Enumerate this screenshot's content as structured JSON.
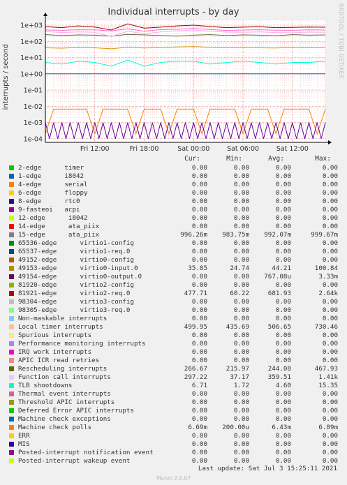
{
  "chart_data": {
    "type": "line",
    "title": "Individual interrupts - by day",
    "side_credit": "RRDTOOL / TOBI OETIKER",
    "ylabel": "interrupts / second",
    "yscale": "log",
    "ylim": [
      6e-05,
      2000
    ],
    "ytick_labels": [
      "1e+03",
      "1e+02",
      "1e+01",
      "1e+00",
      "1e-01",
      "1e-02",
      "1e-03",
      "1e-04"
    ],
    "xtick_labels": [
      "Fri 12:00",
      "Fri 18:00",
      "Sat 00:00",
      "Sat 06:00",
      "Sat 12:00"
    ],
    "grid": true,
    "series": [
      {
        "name": "Rescheduling interrupts",
        "color": "#556b2f",
        "x_hours": [
          6,
          8,
          10,
          12,
          14,
          16,
          18,
          20,
          22,
          24,
          26,
          28,
          30,
          32,
          34,
          36,
          38,
          40
        ],
        "values": [
          260,
          230,
          250,
          240,
          210,
          270,
          250,
          230,
          210,
          240,
          260,
          230,
          250,
          240,
          220,
          260,
          240,
          250
        ]
      },
      {
        "name": "Local timer interrupts",
        "color": "#ff66cc",
        "x_hours": [
          6,
          8,
          10,
          12,
          14,
          16,
          18,
          20,
          22,
          24,
          26,
          28,
          30,
          32,
          34,
          36,
          38,
          40
        ],
        "values": [
          500,
          480,
          520,
          510,
          440,
          600,
          420,
          530,
          560,
          620,
          540,
          470,
          500,
          520,
          490,
          480,
          510,
          500
        ]
      },
      {
        "name": "Function call interrupts",
        "color": "#ffaaee",
        "x_hours": [
          6,
          8,
          10,
          12,
          14,
          16,
          18,
          20,
          22,
          24,
          26,
          28,
          30,
          32,
          34,
          36,
          38,
          40
        ],
        "values": [
          400,
          350,
          380,
          360,
          200,
          420,
          300,
          380,
          450,
          500,
          420,
          370,
          360,
          380,
          350,
          340,
          370,
          360
        ]
      },
      {
        "name": "81921-edge virtio2-req.0",
        "color": "#aa0000",
        "x_hours": [
          6,
          8,
          10,
          12,
          14,
          16,
          18,
          20,
          22,
          24,
          26,
          28,
          30,
          32,
          34,
          36,
          38,
          40
        ],
        "values": [
          800,
          700,
          900,
          760,
          500,
          1200,
          650,
          750,
          900,
          1000,
          820,
          700,
          750,
          800,
          700,
          720,
          760,
          740
        ]
      },
      {
        "name": "15-edge ata_piix",
        "color": "#cc9900",
        "x_hours": [
          6,
          8,
          10,
          12,
          14,
          16,
          18,
          20,
          22,
          24,
          26,
          28,
          30,
          32,
          34,
          36,
          38,
          40
        ],
        "values": [
          40,
          38,
          42,
          40,
          35,
          44,
          39,
          41,
          45,
          48,
          43,
          40,
          41,
          40,
          39,
          42,
          40,
          41
        ]
      },
      {
        "name": "TLB shootdowns",
        "color": "#00ffcc",
        "x_hours": [
          6,
          8,
          10,
          12,
          14,
          16,
          18,
          20,
          22,
          24,
          26,
          28,
          30,
          32,
          34,
          36,
          38,
          40
        ],
        "values": [
          5,
          4,
          6,
          5,
          3,
          7,
          3,
          5,
          6,
          6,
          4,
          5,
          6,
          5,
          4,
          5,
          5,
          6
        ]
      },
      {
        "name": "Non-maskable interrupts",
        "color": "#0066b3",
        "x_hours": [
          6,
          40
        ],
        "values": [
          0.996,
          0.996
        ]
      },
      {
        "name": "Machine check polls",
        "color": "#ff8000",
        "x_hours": [
          6,
          7,
          8,
          9,
          10,
          11,
          12,
          13,
          14,
          15,
          16,
          17,
          18,
          19,
          20,
          21,
          22,
          23,
          24,
          25,
          26,
          27,
          28,
          29,
          30,
          31,
          32,
          33,
          34,
          35,
          36,
          37,
          38,
          39,
          40
        ],
        "values": [
          0.0002,
          0.0067,
          0.0067,
          0.0067,
          0.0067,
          0.0067,
          0.0002,
          0.0067,
          0.0067,
          0.0067,
          0.0067,
          0.0002,
          0.0067,
          0.0067,
          0.0067,
          0.0002,
          0.0067,
          0.0067,
          0.0067,
          0.0002,
          0.0067,
          0.0067,
          0.0067,
          0.0067,
          0.0002,
          0.0067,
          0.0067,
          0.0067,
          0.0002,
          0.0067,
          0.0067,
          0.0067,
          0.0067,
          0.0002,
          0.0067
        ]
      },
      {
        "name": "49154-edge virtio0-output.0",
        "color": "#660099",
        "x_hours": [
          6,
          6.5,
          7,
          7.5,
          8,
          8.5,
          9,
          9.5,
          10,
          10.5,
          11,
          11.5,
          12,
          12.5,
          13,
          13.5,
          14,
          14.5,
          15,
          15.5,
          16,
          16.5,
          17,
          17.5,
          18,
          18.5,
          19,
          19.5,
          20,
          20.5,
          21,
          21.5,
          22,
          22.5,
          23,
          23.5,
          24,
          24.5,
          25,
          25.5,
          26,
          26.5,
          27,
          27.5,
          28,
          28.5,
          29,
          29.5,
          30,
          30.5,
          31,
          31.5,
          32,
          32.5,
          33,
          33.5,
          34,
          34.5,
          35,
          35.5,
          36,
          36.5,
          37,
          37.5,
          38,
          38.5,
          39,
          39.5,
          40
        ],
        "values": [
          0.001,
          0.0001,
          0.001,
          0.0001,
          0.001,
          0.0001,
          0.001,
          0.0001,
          0.001,
          0.0001,
          0.001,
          0.0001,
          0.001,
          0.0001,
          0.001,
          0.0001,
          0.001,
          0.0001,
          0.001,
          0.0001,
          0.001,
          0.0001,
          0.001,
          0.0001,
          0.001,
          0.0001,
          0.001,
          0.0001,
          0.001,
          0.0001,
          0.001,
          0.0001,
          0.001,
          0.0001,
          0.001,
          0.0001,
          0.001,
          0.0001,
          0.001,
          0.0001,
          0.001,
          0.0001,
          0.001,
          0.0001,
          0.001,
          0.0001,
          0.001,
          0.0001,
          0.001,
          0.0001,
          0.001,
          0.0001,
          0.001,
          0.0001,
          0.001,
          0.0001,
          0.001,
          0.0001,
          0.001,
          0.0001,
          0.001,
          0.0001,
          0.001,
          0.0001,
          0.001,
          0.0001,
          0.001,
          0.0001,
          0.001
        ]
      }
    ]
  },
  "legend": {
    "headers": [
      "Cur:",
      "Min:",
      "Avg:",
      "Max:"
    ],
    "rows": [
      {
        "label": "2-edge      timer",
        "color": "#00cc00",
        "cur": "0.00",
        "min": "0.00",
        "avg": "0.00",
        "max": "0.00"
      },
      {
        "label": "1-edge      i8042",
        "color": "#0066b3",
        "cur": "0.00",
        "min": "0.00",
        "avg": "0.00",
        "max": "0.00"
      },
      {
        "label": "4-edge      serial",
        "color": "#ff8000",
        "cur": "0.00",
        "min": "0.00",
        "avg": "0.00",
        "max": "0.00"
      },
      {
        "label": "6-edge      floppy",
        "color": "#ffcc00",
        "cur": "0.00",
        "min": "0.00",
        "avg": "0.00",
        "max": "0.00"
      },
      {
        "label": "8-edge      rtc0",
        "color": "#330099",
        "cur": "0.00",
        "min": "0.00",
        "avg": "0.00",
        "max": "0.00"
      },
      {
        "label": "9-fasteoi   acpi",
        "color": "#990099",
        "cur": "0.00",
        "min": "0.00",
        "avg": "0.00",
        "max": "0.00"
      },
      {
        "label": "12-edge      i8042",
        "color": "#ccff00",
        "cur": "0.00",
        "min": "0.00",
        "avg": "0.00",
        "max": "0.00"
      },
      {
        "label": "14-edge      ata_piix",
        "color": "#ff0000",
        "cur": "0.00",
        "min": "0.00",
        "avg": "0.00",
        "max": "0.00"
      },
      {
        "label": "15-edge      ata_piix",
        "color": "#808080",
        "cur": "996.26m",
        "min": "983.75m",
        "avg": "992.07m",
        "max": "999.67m"
      },
      {
        "label": "65536-edge      virtio1-config",
        "color": "#008f00",
        "cur": "0.00",
        "min": "0.00",
        "avg": "0.00",
        "max": "0.00"
      },
      {
        "label": "65537-edge      virtio1-req.0",
        "color": "#00487d",
        "cur": "0.00",
        "min": "0.00",
        "avg": "0.00",
        "max": "0.00"
      },
      {
        "label": "49152-edge      virtio0-config",
        "color": "#b35a00",
        "cur": "0.00",
        "min": "0.00",
        "avg": "0.00",
        "max": "0.00"
      },
      {
        "label": "49153-edge      virtio0-input.0",
        "color": "#b38f00",
        "cur": "35.85",
        "min": "24.74",
        "avg": "44.21",
        "max": "100.84"
      },
      {
        "label": "49154-edge      virtio0-output.0",
        "color": "#6b006b",
        "cur": "0.00",
        "min": "0.00",
        "avg": "767.08u",
        "max": "3.33m"
      },
      {
        "label": "81920-edge      virtio2-config",
        "color": "#8fb300",
        "cur": "0.00",
        "min": "0.00",
        "avg": "0.00",
        "max": "0.00"
      },
      {
        "label": "81921-edge      virtio2-req.0",
        "color": "#b30000",
        "cur": "477.71",
        "min": "60.22",
        "avg": "681.93",
        "max": "2.64k"
      },
      {
        "label": "98304-edge      virtio3-config",
        "color": "#bebebe",
        "cur": "0.00",
        "min": "0.00",
        "avg": "0.00",
        "max": "0.00"
      },
      {
        "label": "98305-edge      virtio3-req.0",
        "color": "#80ff80",
        "cur": "0.00",
        "min": "0.00",
        "avg": "0.00",
        "max": "0.00"
      },
      {
        "label": "Non-maskable interrupts",
        "color": "#80c9ff",
        "cur": "0.00",
        "min": "0.00",
        "avg": "0.00",
        "max": "0.00"
      },
      {
        "label": "Local timer interrupts",
        "color": "#ffc080",
        "cur": "499.95",
        "min": "435.69",
        "avg": "506.65",
        "max": "730.46"
      },
      {
        "label": "Spurious interrupts",
        "color": "#ffe680",
        "cur": "0.00",
        "min": "0.00",
        "avg": "0.00",
        "max": "0.00"
      },
      {
        "label": "Performance monitoring interrupts",
        "color": "#aa80ff",
        "cur": "0.00",
        "min": "0.00",
        "avg": "0.00",
        "max": "0.00"
      },
      {
        "label": "IRQ work interrupts",
        "color": "#ee00cc",
        "cur": "0.00",
        "min": "0.00",
        "avg": "0.00",
        "max": "0.00"
      },
      {
        "label": "APIC ICR read retries",
        "color": "#ff8080",
        "cur": "0.00",
        "min": "0.00",
        "avg": "0.00",
        "max": "0.00"
      },
      {
        "label": "Rescheduling interrupts",
        "color": "#666600",
        "cur": "266.67",
        "min": "215.97",
        "avg": "244.08",
        "max": "467.93"
      },
      {
        "label": "Function call interrupts",
        "color": "#ffbfff",
        "cur": "297.22",
        "min": "37.17",
        "avg": "359.51",
        "max": "1.41k"
      },
      {
        "label": "TLB shootdowns",
        "color": "#00ffcc",
        "cur": "6.71",
        "min": "1.72",
        "avg": "4.60",
        "max": "15.35"
      },
      {
        "label": "Thermal event interrupts",
        "color": "#cc6699",
        "cur": "0.00",
        "min": "0.00",
        "avg": "0.00",
        "max": "0.00"
      },
      {
        "label": "Threshold APIC interrupts",
        "color": "#999900",
        "cur": "0.00",
        "min": "0.00",
        "avg": "0.00",
        "max": "0.00"
      },
      {
        "label": "Deferred Error APIC interrupts",
        "color": "#00cc00",
        "cur": "0.00",
        "min": "0.00",
        "avg": "0.00",
        "max": "0.00"
      },
      {
        "label": "Machine check exceptions",
        "color": "#0066b3",
        "cur": "0.00",
        "min": "0.00",
        "avg": "0.00",
        "max": "0.00"
      },
      {
        "label": "Machine check polls",
        "color": "#ff8000",
        "cur": "6.69m",
        "min": "200.00u",
        "avg": "6.43m",
        "max": "6.89m"
      },
      {
        "label": "ERR",
        "color": "#ffcc00",
        "cur": "0.00",
        "min": "0.00",
        "avg": "0.00",
        "max": "0.00"
      },
      {
        "label": "MIS",
        "color": "#330099",
        "cur": "0.00",
        "min": "0.00",
        "avg": "0.00",
        "max": "0.00"
      },
      {
        "label": "Posted-interrupt notification event",
        "color": "#990099",
        "cur": "0.00",
        "min": "0.00",
        "avg": "0.00",
        "max": "0.00"
      },
      {
        "label": "Posted-interrupt wakeup event",
        "color": "#ccff00",
        "cur": "0.00",
        "min": "0.00",
        "avg": "0.00",
        "max": "0.00"
      }
    ]
  },
  "footer": {
    "last_update": "Last update: Sat Jul  3 15:25:11 2021",
    "munin": "Munin 2.0.67"
  }
}
